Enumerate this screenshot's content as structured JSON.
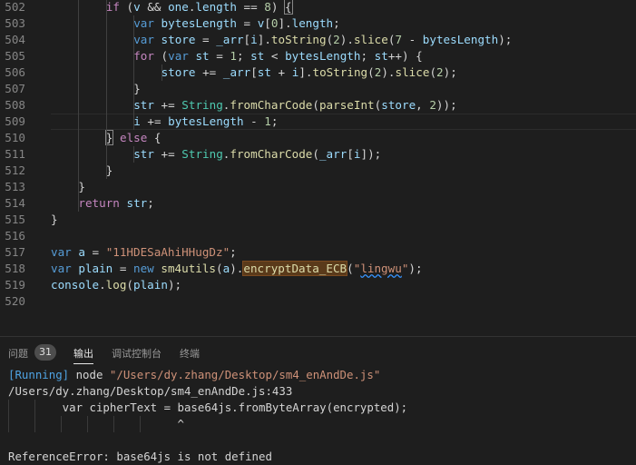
{
  "editor": {
    "lines": [
      {
        "num": "502",
        "segs": [
          [
            "ctl",
            "if"
          ],
          [
            "pn",
            " ("
          ],
          [
            "var",
            "v"
          ],
          [
            "pn",
            " && "
          ],
          [
            "var",
            "one"
          ],
          [
            "pn",
            "."
          ],
          [
            "var",
            "length"
          ],
          [
            "pn",
            " == "
          ],
          [
            "num",
            "8"
          ],
          [
            "pn",
            ") "
          ],
          [
            "pnb",
            "{"
          ]
        ]
      },
      {
        "num": "503",
        "segs": [
          [
            "kw",
            "var"
          ],
          [
            "pn",
            " "
          ],
          [
            "var",
            "bytesLength"
          ],
          [
            "pn",
            " = "
          ],
          [
            "var",
            "v"
          ],
          [
            "pn",
            "["
          ],
          [
            "num",
            "0"
          ],
          [
            "pn",
            "]."
          ],
          [
            "var",
            "length"
          ],
          [
            "pn",
            ";"
          ]
        ]
      },
      {
        "num": "504",
        "segs": [
          [
            "kw",
            "var"
          ],
          [
            "pn",
            " "
          ],
          [
            "var",
            "store"
          ],
          [
            "pn",
            " = "
          ],
          [
            "var",
            "_arr"
          ],
          [
            "pn",
            "["
          ],
          [
            "var",
            "i"
          ],
          [
            "pn",
            "]."
          ],
          [
            "fn",
            "toString"
          ],
          [
            "pn",
            "("
          ],
          [
            "num",
            "2"
          ],
          [
            "pn",
            ")."
          ],
          [
            "fn",
            "slice"
          ],
          [
            "pn",
            "("
          ],
          [
            "num",
            "7"
          ],
          [
            "pn",
            " - "
          ],
          [
            "var",
            "bytesLength"
          ],
          [
            "pn",
            ");"
          ]
        ]
      },
      {
        "num": "505",
        "segs": [
          [
            "ctl",
            "for"
          ],
          [
            "pn",
            " ("
          ],
          [
            "kw",
            "var"
          ],
          [
            "pn",
            " "
          ],
          [
            "var",
            "st"
          ],
          [
            "pn",
            " = "
          ],
          [
            "num",
            "1"
          ],
          [
            "pn",
            "; "
          ],
          [
            "var",
            "st"
          ],
          [
            "pn",
            " < "
          ],
          [
            "var",
            "bytesLength"
          ],
          [
            "pn",
            "; "
          ],
          [
            "var",
            "st"
          ],
          [
            "pn",
            "++) {"
          ]
        ]
      },
      {
        "num": "506",
        "segs": [
          [
            "var",
            "store"
          ],
          [
            "pn",
            " += "
          ],
          [
            "var",
            "_arr"
          ],
          [
            "pn",
            "["
          ],
          [
            "var",
            "st"
          ],
          [
            "pn",
            " + "
          ],
          [
            "var",
            "i"
          ],
          [
            "pn",
            "]."
          ],
          [
            "fn",
            "toString"
          ],
          [
            "pn",
            "("
          ],
          [
            "num",
            "2"
          ],
          [
            "pn",
            ")."
          ],
          [
            "fn",
            "slice"
          ],
          [
            "pn",
            "("
          ],
          [
            "num",
            "2"
          ],
          [
            "pn",
            ");"
          ]
        ]
      },
      {
        "num": "507",
        "segs": [
          [
            "pn",
            "}"
          ]
        ]
      },
      {
        "num": "508",
        "segs": [
          [
            "var",
            "str"
          ],
          [
            "pn",
            " += "
          ],
          [
            "cls",
            "String"
          ],
          [
            "pn",
            "."
          ],
          [
            "fn",
            "fromCharCode"
          ],
          [
            "pn",
            "("
          ],
          [
            "fn",
            "parseInt"
          ],
          [
            "pn",
            "("
          ],
          [
            "var",
            "store"
          ],
          [
            "pn",
            ", "
          ],
          [
            "num",
            "2"
          ],
          [
            "pn",
            "));"
          ]
        ]
      },
      {
        "num": "509",
        "segs": [
          [
            "var",
            "i"
          ],
          [
            "pn",
            " += "
          ],
          [
            "var",
            "bytesLength"
          ],
          [
            "pn",
            " - "
          ],
          [
            "num",
            "1"
          ],
          [
            "pn",
            ";"
          ]
        ]
      },
      {
        "num": "510",
        "segs": [
          [
            "pnb",
            "}"
          ],
          [
            "pn",
            " "
          ],
          [
            "ctl",
            "else"
          ],
          [
            "pn",
            " {"
          ]
        ]
      },
      {
        "num": "511",
        "segs": [
          [
            "var",
            "str"
          ],
          [
            "pn",
            " += "
          ],
          [
            "cls",
            "String"
          ],
          [
            "pn",
            "."
          ],
          [
            "fn",
            "fromCharCode"
          ],
          [
            "pn",
            "("
          ],
          [
            "var",
            "_arr"
          ],
          [
            "pn",
            "["
          ],
          [
            "var",
            "i"
          ],
          [
            "pn",
            "]);"
          ]
        ]
      },
      {
        "num": "512",
        "segs": [
          [
            "pn",
            "}"
          ]
        ]
      },
      {
        "num": "513",
        "segs": [
          [
            "pn",
            "}"
          ]
        ]
      },
      {
        "num": "514",
        "segs": [
          [
            "ctl",
            "return"
          ],
          [
            "pn",
            " "
          ],
          [
            "var",
            "str"
          ],
          [
            "pn",
            ";"
          ]
        ]
      },
      {
        "num": "515",
        "segs": [
          [
            "pn",
            "}"
          ]
        ]
      },
      {
        "num": "516",
        "segs": []
      },
      {
        "num": "517",
        "segs": [
          [
            "kw",
            "var"
          ],
          [
            "pn",
            " "
          ],
          [
            "var",
            "a"
          ],
          [
            "pn",
            " = "
          ],
          [
            "str",
            "\"11HDESaAhiHHugDz\""
          ],
          [
            "pn",
            ";"
          ]
        ]
      },
      {
        "num": "518",
        "segs": [
          [
            "kw",
            "var"
          ],
          [
            "pn",
            " "
          ],
          [
            "var",
            "plain"
          ],
          [
            "pn",
            " = "
          ],
          [
            "kw",
            "new"
          ],
          [
            "pn",
            " "
          ],
          [
            "fn",
            "sm4utils"
          ],
          [
            "pn",
            "("
          ],
          [
            "var",
            "a"
          ],
          [
            "pn",
            ")."
          ],
          [
            "fnhl",
            "encryptData_ECB"
          ],
          [
            "pn",
            "("
          ],
          [
            "str",
            "\""
          ],
          [
            "strsq",
            "lingwu"
          ],
          [
            "str",
            "\""
          ],
          [
            "pn",
            ");"
          ]
        ]
      },
      {
        "num": "519",
        "segs": [
          [
            "var",
            "console"
          ],
          [
            "pn",
            "."
          ],
          [
            "fn",
            "log"
          ],
          [
            "pn",
            "("
          ],
          [
            "var",
            "plain"
          ],
          [
            "pn",
            ");"
          ]
        ]
      },
      {
        "num": "520",
        "segs": []
      }
    ]
  },
  "panel": {
    "tabs": [
      {
        "label": "问题",
        "active": false
      },
      {
        "label": "输出",
        "active": true
      },
      {
        "label": "调试控制台",
        "active": false
      },
      {
        "label": "终端",
        "active": false
      }
    ],
    "problems_count": "31",
    "output": {
      "running_tag": "[Running]",
      "command_prefix": " node ",
      "command_path": "\"/Users/dy.zhang/Desktop/sm4_enAndDe.js\"",
      "error_location": "/Users/dy.zhang/Desktop/sm4_enAndDe.js:433",
      "error_source": "        var cipherText = base64js.fromByteArray(encrypted);",
      "error_caret": "                         ^",
      "error_message": "ReferenceError: base64js is not defined"
    }
  }
}
